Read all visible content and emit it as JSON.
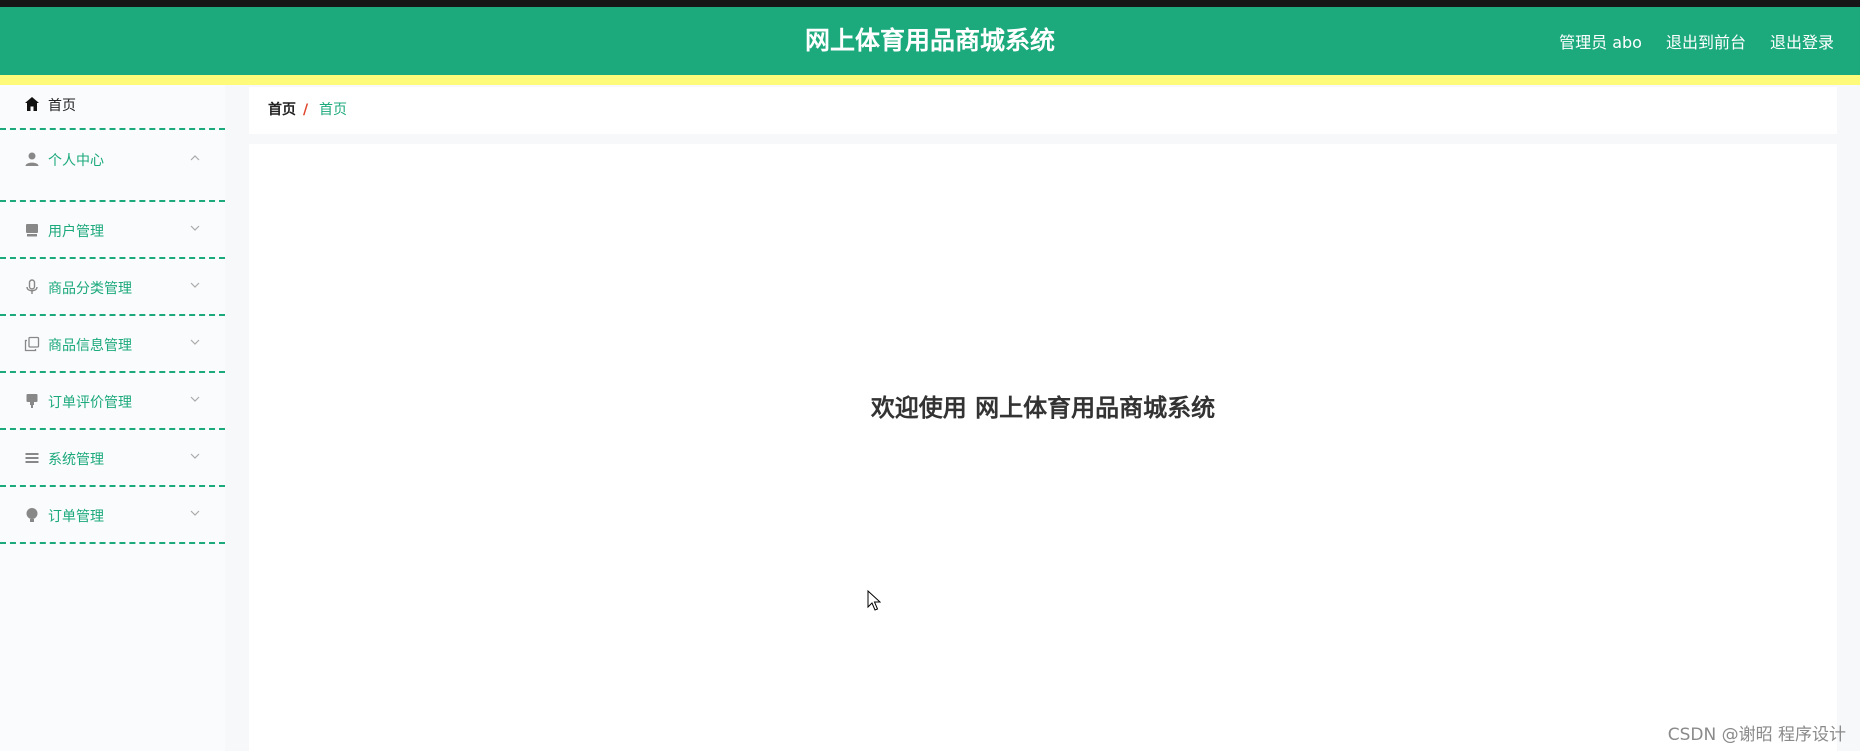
{
  "header": {
    "title": "网上体育用品商城系统",
    "user_label": "管理员 abo",
    "to_frontend": "退出到前台",
    "logout": "退出登录"
  },
  "sidebar": {
    "items": [
      {
        "label": "首页",
        "icon": "home-icon"
      },
      {
        "label": "个人中心",
        "icon": "user-icon"
      },
      {
        "label": "用户管理",
        "icon": "tray-icon"
      },
      {
        "label": "商品分类管理",
        "icon": "microphone-icon"
      },
      {
        "label": "商品信息管理",
        "icon": "copy-icon"
      },
      {
        "label": "订单评价管理",
        "icon": "stamp-icon"
      },
      {
        "label": "系统管理",
        "icon": "list-icon"
      },
      {
        "label": "订单管理",
        "icon": "bulb-icon"
      }
    ]
  },
  "breadcrumb": {
    "root": "首页",
    "separator": "/",
    "current": "首页"
  },
  "main": {
    "welcome": "欢迎使用 网上体育用品商城系统"
  },
  "watermark": "CSDN @谢昭  程序设计",
  "colors": {
    "primary": "#1ca97c",
    "accent_bar": "#fffb7a",
    "separator": "#e0452b"
  }
}
